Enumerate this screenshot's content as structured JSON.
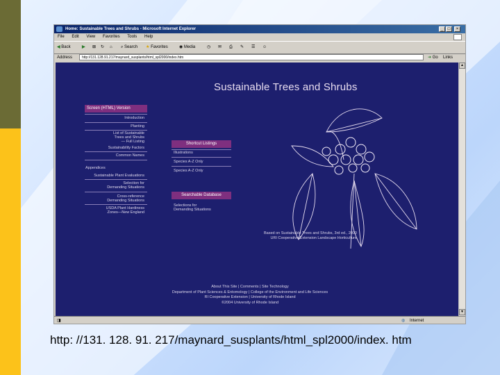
{
  "window": {
    "title": "Home: Sustainable Trees and Shrubs - Microsoft Internet Explorer",
    "menu": [
      "File",
      "Edit",
      "View",
      "Favorites",
      "Tools",
      "Help"
    ],
    "toolbar": {
      "back": "Back",
      "search": "Search",
      "favorites": "Favorites",
      "media": "Media"
    },
    "address_label": "Address",
    "address_value": "http://131.128.91.217/maynard_susplants/html_spl2000/index.htm",
    "go_label": "Go",
    "links_label": "Links",
    "status_text": "Internet"
  },
  "site": {
    "title": "Sustainable Trees and Shrubs",
    "left_nav": {
      "header": "Screen (HTML) Version",
      "groups": [
        [
          "Introduction"
        ],
        [
          "Planting"
        ],
        [
          "List of Sustainable",
          "Trees and Shrubs",
          "— Full Listing"
        ],
        [
          "Sustainability Factors"
        ],
        [
          "Common Names"
        ],
        [
          "Appendices"
        ],
        [
          "Sustainable Plant Evaluations"
        ],
        [
          "Selection for",
          "Demanding Situations"
        ],
        [
          "Cross-reference",
          "Demanding Situations"
        ],
        [
          "USDA Plant Hardiness",
          "Zones—New England"
        ]
      ]
    },
    "right_nav": {
      "header1": "Shortcut Listings",
      "links1": [
        "Illustrations",
        "Species A-Z Only",
        "Species A-Z Only"
      ],
      "header2": "Searchable Database",
      "links2": [
        "Selections for",
        "Demanding Situations"
      ]
    },
    "credit": [
      "Based on Sustainable Trees and Shrubs, 3rd ed., 2000",
      "URI Cooperative Extension Landscape Horticulture"
    ],
    "footer": [
      "About This Site | Comments | Site Technology",
      "Department of Plant Sciences & Entomology | College of the Environment and Life Sciences",
      "RI Cooperative Extension | University of Rhode Island",
      "©2004 University of Rhode Island"
    ]
  },
  "caption": "http: //131. 128. 91. 217/maynard_susplants/html_spl2000/index. htm",
  "colors": {
    "page_bg": "#1d1f6e",
    "nav_header": "#7f2f7f",
    "accent_yellow": "#fcc21a",
    "accent_olive": "#6b6b35"
  }
}
